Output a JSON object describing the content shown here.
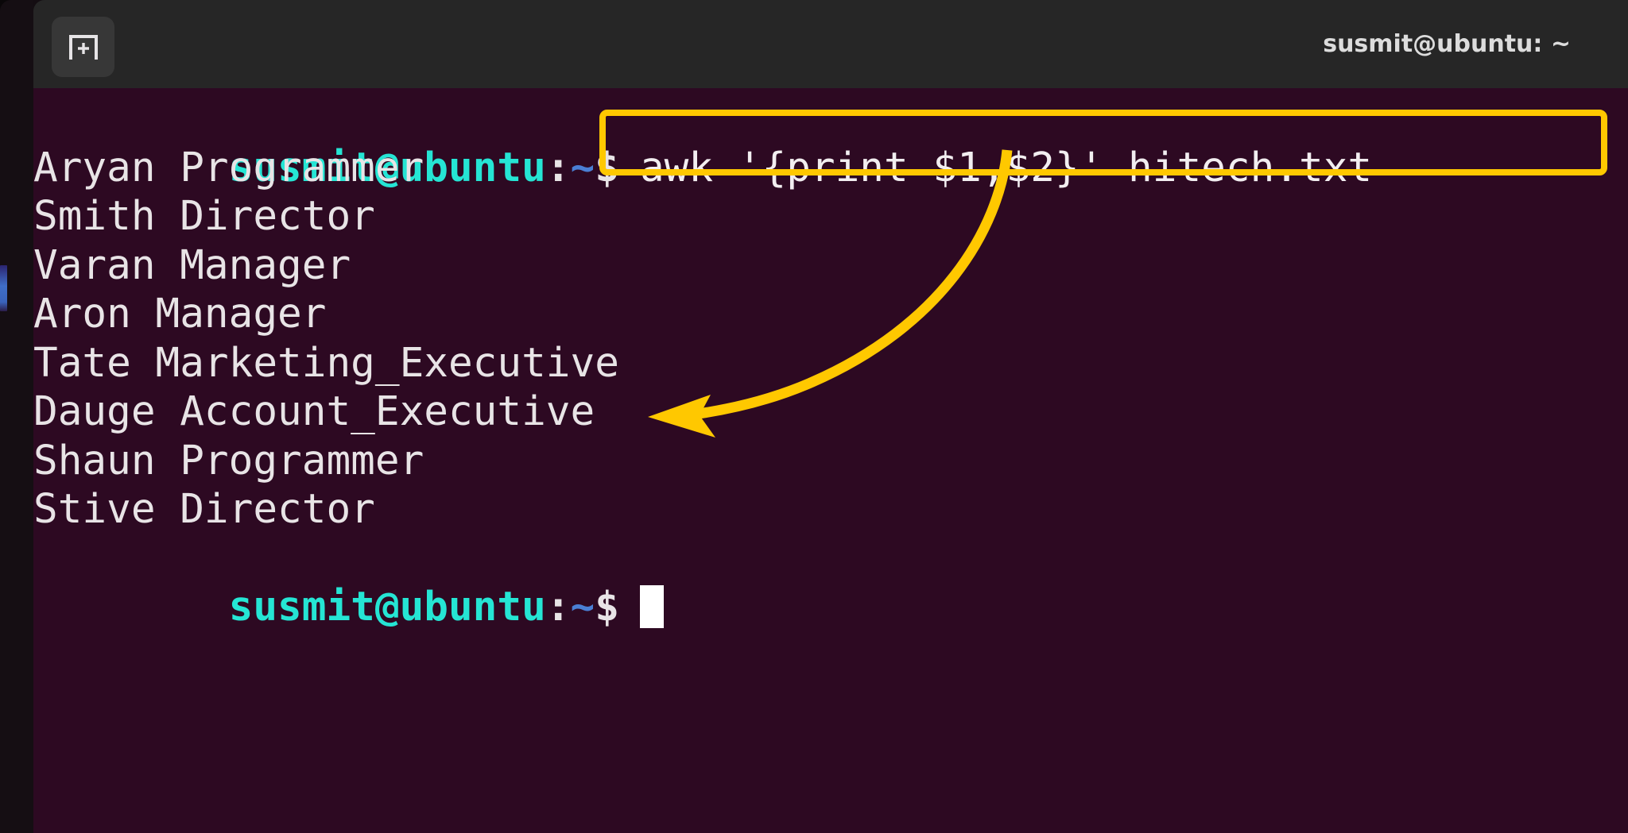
{
  "window": {
    "title": "susmit@ubuntu: ~",
    "background_color": "#2d0922",
    "tabbar_color": "#262626"
  },
  "tabbar": {
    "new_tab_icon": "new-tab-plus-icon",
    "new_tab_label": "+"
  },
  "terminal": {
    "prompt": {
      "user_host": "susmit@ubuntu",
      "colon": ":",
      "path": "~",
      "dollar": "$"
    },
    "command": "awk '{print $1,$2}' hitech.txt",
    "output_lines": [
      "Aryan Programmer",
      "Smith Director",
      "Varan Manager",
      "Aron Manager",
      "Tate Marketing_Executive",
      "Dauge Account_Executive",
      "Shaun Programmer",
      "Stive Director"
    ],
    "cursor": "block"
  },
  "annotation": {
    "highlight_color": "#ffc800",
    "arrow_color": "#ffc800",
    "target": "awk '{print $1,$2}' hitech.txt"
  },
  "colors": {
    "prompt_user": "#25e5d4",
    "prompt_path": "#4a7fd4",
    "text": "#e8e4e6",
    "accent_yellow": "#ffc800",
    "scroll_indicator": "#3f6ec8"
  }
}
